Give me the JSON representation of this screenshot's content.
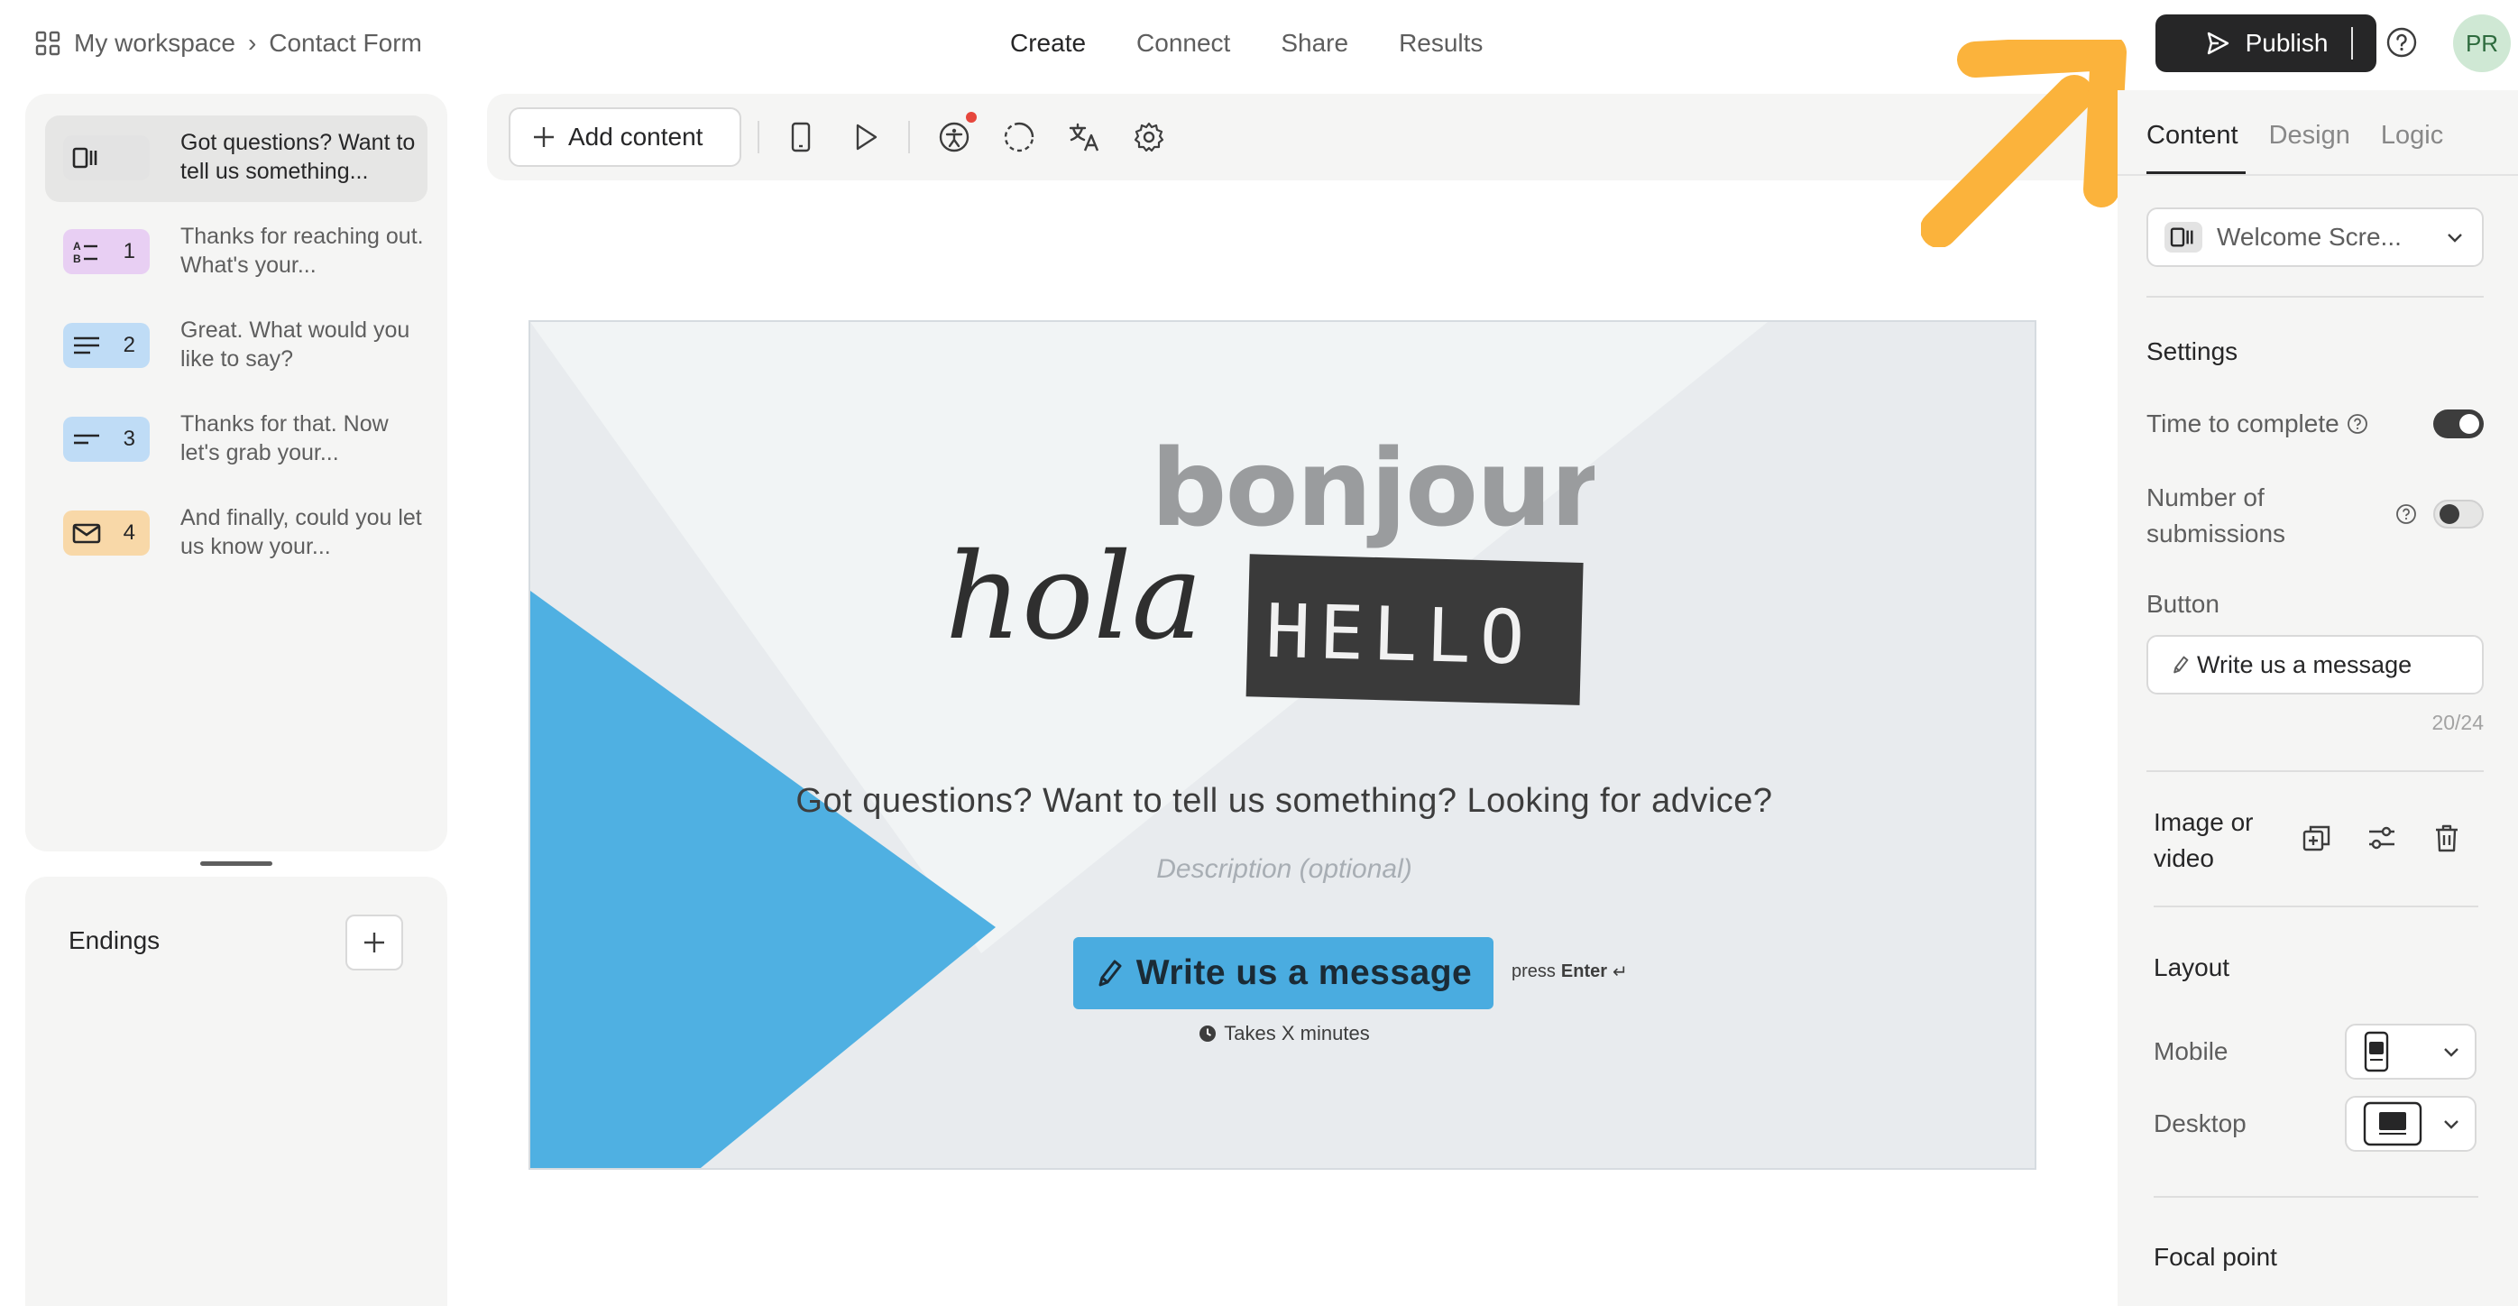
{
  "breadcrumb": {
    "workspace": "My workspace",
    "separator": "›",
    "form": "Contact Form"
  },
  "nav": {
    "tabs": [
      "Create",
      "Connect",
      "Share",
      "Results"
    ],
    "active": "Create"
  },
  "header": {
    "publish_label": "Publish",
    "avatar_initials": "PR"
  },
  "questions": [
    {
      "num": "",
      "text": "Got questions? Want to tell us something...",
      "color": "#e3e3e3",
      "icon": "welcome-screen-icon"
    },
    {
      "num": "1",
      "text": "Thanks for reaching out. What's your...",
      "color": "#e8cff3",
      "icon": "multiple-choice-icon"
    },
    {
      "num": "2",
      "text": "Great. What would you like to say?",
      "color": "#bfdcf6",
      "icon": "long-text-icon"
    },
    {
      "num": "3",
      "text": "Thanks for that. Now let's grab your...",
      "color": "#bfdcf6",
      "icon": "short-text-icon"
    },
    {
      "num": "4",
      "text": "And finally, could you let us know your...",
      "color": "#f8d8a8",
      "icon": "email-icon"
    }
  ],
  "endings": {
    "label": "Endings"
  },
  "toolbar": {
    "add_content_label": "Add content"
  },
  "canvas": {
    "image_words": {
      "bonjour": "bonjour",
      "hola": "hola",
      "hello": "HELLO"
    },
    "title": "Got questions? Want to tell us something? Looking for advice?",
    "description_placeholder": "Description (optional)",
    "button_label": "Write us a message",
    "press": "press",
    "enter": "Enter",
    "enter_glyph": "↵",
    "takes": "Takes X minutes",
    "accent_color": "#4aace0"
  },
  "right_panel": {
    "tabs": [
      "Content",
      "Design",
      "Logic"
    ],
    "active_tab": "Content",
    "block_type": "Welcome Scre...",
    "settings_heading": "Settings",
    "time_to_complete_label": "Time to complete",
    "time_to_complete_on": true,
    "submissions_label_line1": "Number of",
    "submissions_label_line2": "submissions",
    "submissions_on": false,
    "button_heading": "Button",
    "button_value": "Write us a message",
    "char_count": "20/24",
    "image_label_line1": "Image or",
    "image_label_line2": "video",
    "layout_heading": "Layout",
    "mobile_label": "Mobile",
    "desktop_label": "Desktop",
    "focal_point_heading": "Focal point"
  },
  "annotation": {
    "arrow_color": "#fbb33c"
  }
}
